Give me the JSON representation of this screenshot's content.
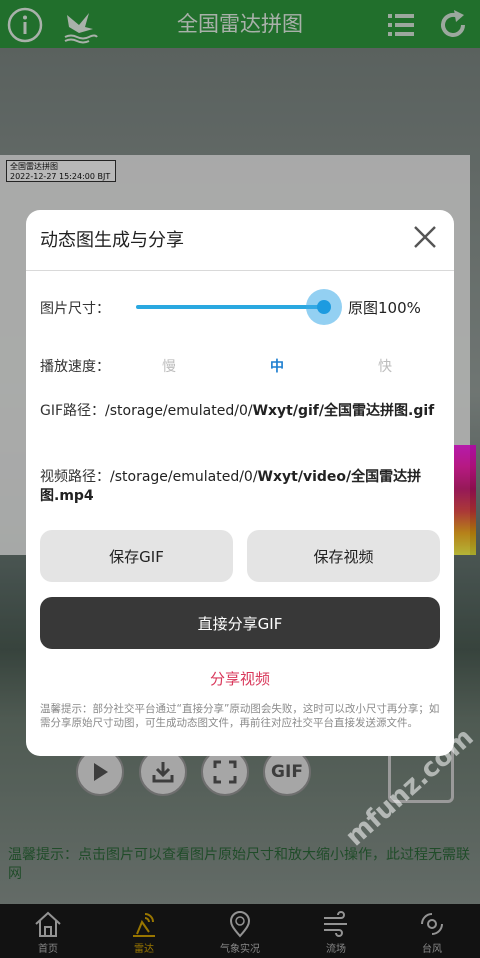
{
  "app": {
    "title": "全国雷达拼图",
    "map_stamp_title": "全国雷达拼图",
    "map_stamp_time": "2022-12-27 15:24:00 BJT",
    "bottom_tip": "温馨提示：点击图片可以查看图片原始尺寸和放大缩小操作，此过程无需联网",
    "gif_button_label": "GIF",
    "watermark": "mfunz.com"
  },
  "tabbar": {
    "tabs": [
      {
        "label": "首页",
        "icon": "home-icon",
        "active": false
      },
      {
        "label": "雷达",
        "icon": "radar-icon",
        "active": true
      },
      {
        "label": "气象实况",
        "icon": "weather-icon",
        "active": false
      },
      {
        "label": "流场",
        "icon": "wind-icon",
        "active": false
      },
      {
        "label": "台风",
        "icon": "typhoon-icon",
        "active": false
      }
    ]
  },
  "dialog": {
    "title": "动态图生成与分享",
    "size_label": "图片尺寸：",
    "size_percent": 100,
    "size_value": "原图100%",
    "speed_label": "播放速度：",
    "speed_options": [
      "慢",
      "中",
      "快"
    ],
    "speed_selected": "中",
    "gif_path_label": "GIF路径：",
    "gif_path_prefix": "/storage/emulated/0/",
    "gif_path_bold": "Wxyt/gif/全国雷达拼图.gif",
    "video_path_label": "视频路径：",
    "video_path_prefix": "/storage/emulated/0/",
    "video_path_bold": "Wxyt/video/全国雷达拼图.mp4",
    "save_gif": "保存GIF",
    "save_video": "保存视频",
    "share_gif": "直接分享GIF",
    "share_video": "分享视频",
    "note": "温馨提示：部分社交平台通过“直接分享”原动图会失败，这时可以改小尺寸再分享；如需分享原始尺寸动图，可生成动态图文件，再前往对应社交平台直接发送源文件。"
  },
  "colors": {
    "header": "#2e9a3e",
    "accent_blue": "#1e7fd0",
    "share_link": "#d9385b",
    "dark_button": "#383838"
  }
}
